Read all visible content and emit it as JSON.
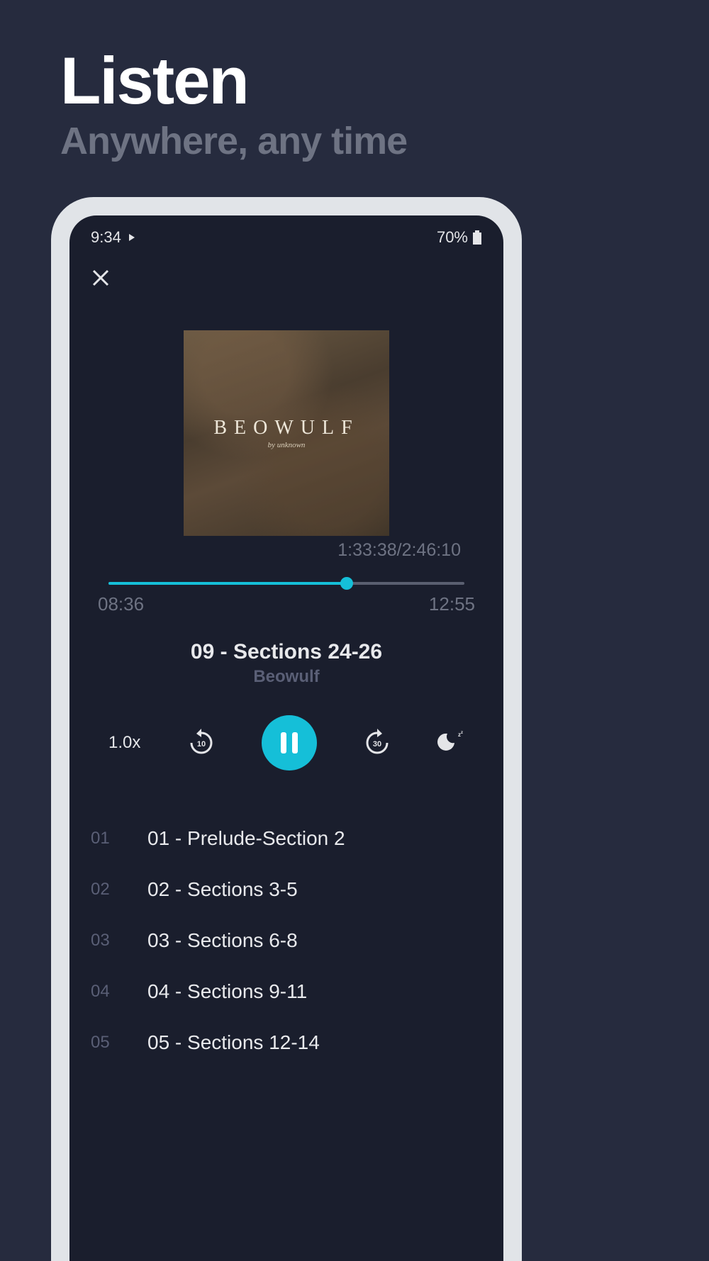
{
  "promo": {
    "title": "Listen",
    "subtitle": "Anywhere, any time"
  },
  "status": {
    "time": "9:34",
    "battery": "70%"
  },
  "cover": {
    "title": "BEOWULF",
    "byline": "by unknown"
  },
  "overall_time": "1:33:38/2:46:10",
  "progress": {
    "current": "08:36",
    "end": "12:55",
    "percent": 67
  },
  "track": {
    "title": "09 - Sections 24-26",
    "book": "Beowulf"
  },
  "controls": {
    "speed": "1.0x",
    "rewind_seconds": "10",
    "forward_seconds": "30"
  },
  "chapters": [
    {
      "num": "01",
      "title": "01 - Prelude-Section 2"
    },
    {
      "num": "02",
      "title": "02 - Sections 3-5"
    },
    {
      "num": "03",
      "title": "03 - Sections 6-8"
    },
    {
      "num": "04",
      "title": "04 - Sections 9-11"
    },
    {
      "num": "05",
      "title": "05 - Sections 12-14"
    }
  ]
}
